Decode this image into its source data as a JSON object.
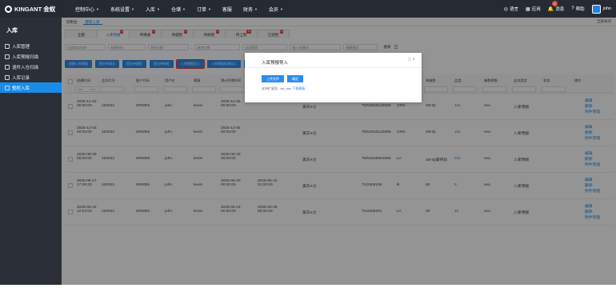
{
  "app": {
    "logo": "KINGANT 金蚁"
  },
  "nav": [
    {
      "label": "控制中心",
      "caret": true
    },
    {
      "label": "系统设置",
      "caret": true
    },
    {
      "label": "入库",
      "caret": true
    },
    {
      "label": "仓储",
      "caret": true
    },
    {
      "label": "订单",
      "caret": true
    },
    {
      "label": "客服",
      "caret": false
    },
    {
      "label": "财务",
      "caret": true
    },
    {
      "label": "会员",
      "caret": true
    }
  ],
  "topright": {
    "lang": "语言",
    "apps": "应用",
    "msg": "消息",
    "msg_badge": "4",
    "help": "帮助",
    "user": "john"
  },
  "sidebar": {
    "title": "入库",
    "items": [
      {
        "label": "入库管理",
        "active": false
      },
      {
        "label": "入库预报扫描",
        "active": false
      },
      {
        "label": "退件入仓扫描",
        "active": false
      },
      {
        "label": "入库记录",
        "active": false
      },
      {
        "label": "整柜入库",
        "active": true
      }
    ]
  },
  "breadcrumb": {
    "items": [
      "控制台",
      "整柜入库"
    ],
    "close_all": "全部关闭"
  },
  "status_tabs": [
    {
      "label": "全部",
      "count": "",
      "active": false
    },
    {
      "label": "入库预报",
      "count": "3",
      "active": true
    },
    {
      "label": "待清关",
      "count": "2",
      "active": false
    },
    {
      "label": "待提柜",
      "count": "2",
      "active": false
    },
    {
      "label": "待拆柜",
      "count": "3",
      "active": false
    },
    {
      "label": "待上架",
      "count": "11",
      "active": false
    },
    {
      "label": "已还柜",
      "count": "6",
      "active": false
    }
  ],
  "filters": {
    "warehouse": "全部库存仓库",
    "time_type": "创建时间",
    "start": "开始日期",
    "sep": "-",
    "end": "结束日期",
    "search_type": "全局搜索",
    "keyword": "输入关键词",
    "match": "模糊搜索",
    "search": "搜索"
  },
  "toolbar": [
    "创建入库预报",
    "提交待清关",
    "提交待提柜",
    "提交待拆柜",
    "入库预报导入",
    "入库预报批量导入",
    "批量修改",
    "批量上传附件",
    "批量下载附件",
    "导出",
    "打印"
  ],
  "table": {
    "headers": [
      "创建时间",
      "会员代号",
      "客户代码",
      "用户名",
      "客服",
      "预计到港时间",
      "到港时间",
      "库存仓库",
      "货柜号",
      "提单号",
      "柜型",
      "装箱数",
      "品类",
      "箱数预报",
      "业务类型",
      "状态",
      "操作"
    ],
    "filter_placeholders": [
      "start",
      "end"
    ],
    "rows": [
      {
        "created": "2025-12-03 00:00:00",
        "member": "100042",
        "client": "WRZBS",
        "user": "john",
        "cs": "kevin",
        "eta": "2025-12-05 00:00:00",
        "ata": "",
        "wh": "美东K仓",
        "cont": "",
        "bl": "TNN2025120306",
        "type": "ORD",
        "size": "40HQ",
        "boxes": "161",
        "biz": "sea",
        "status": "入库预报",
        "ops": [
          "编辑",
          "删除",
          "附件管理"
        ]
      },
      {
        "created": "2025-12-03 00:00:00",
        "member": "100042",
        "client": "WRZBS",
        "user": "john",
        "cs": "kevin",
        "eta": "2025-12-05 00:00:00",
        "ata": "",
        "wh": "美东K仓",
        "cont": "",
        "bl": "TNN2025120306",
        "type": "ORD",
        "size": "40HQ",
        "boxes": "161",
        "biz": "sea",
        "status": "入库预报",
        "ops": [
          "编辑",
          "删除",
          "附件管理"
        ]
      },
      {
        "created": "2025-08-09 00:00:00",
        "member": "100042",
        "client": "WRZBS",
        "user": "john",
        "cs": "kevin",
        "eta": "2025-08-20 00:00:00",
        "ata": "",
        "wh": "美东K仓",
        "cont": "",
        "bl": "TNN2025081805",
        "type": "LA",
        "size": "40HQ美特加",
        "boxes": "311",
        "biz": "sea",
        "status": "入库预报",
        "ops": [
          "编辑",
          "删除",
          "附件管理"
        ]
      },
      {
        "created": "2025-06-17 17:29:23",
        "member": "100042",
        "client": "WRZBS",
        "user": "john",
        "cs": "kevin",
        "eta": "2025-06-20 00:00:00",
        "ata": "2025-06-16 01:00:00",
        "wh": "美东K仓",
        "cont": "",
        "bl": "TG2506106",
        "type": "lk",
        "size": "50",
        "boxes": "5",
        "biz": "sea",
        "status": "入库预报",
        "ops": [
          "编辑",
          "删除",
          "附件管理"
        ]
      },
      {
        "created": "2025-05-22 12:02:03",
        "member": "100042",
        "client": "WRZBS",
        "user": "john",
        "cs": "kevin",
        "eta": "2025-05-23 00:00:00",
        "ata": "2025-05-28 00:00:00",
        "wh": "美东K仓",
        "cont": "",
        "bl": "TG2505201",
        "type": "LA",
        "size": "20",
        "boxes": "40",
        "biz": "sea",
        "status": "入库预报",
        "ops": [
          "编辑",
          "删除",
          "附件管理"
        ]
      }
    ]
  },
  "modal": {
    "title": "入库预报导入",
    "upload": "上传文件",
    "confirm": "确定",
    "hint": "支持扩展名: .xls,.xlsx",
    "download": "下载模板"
  }
}
